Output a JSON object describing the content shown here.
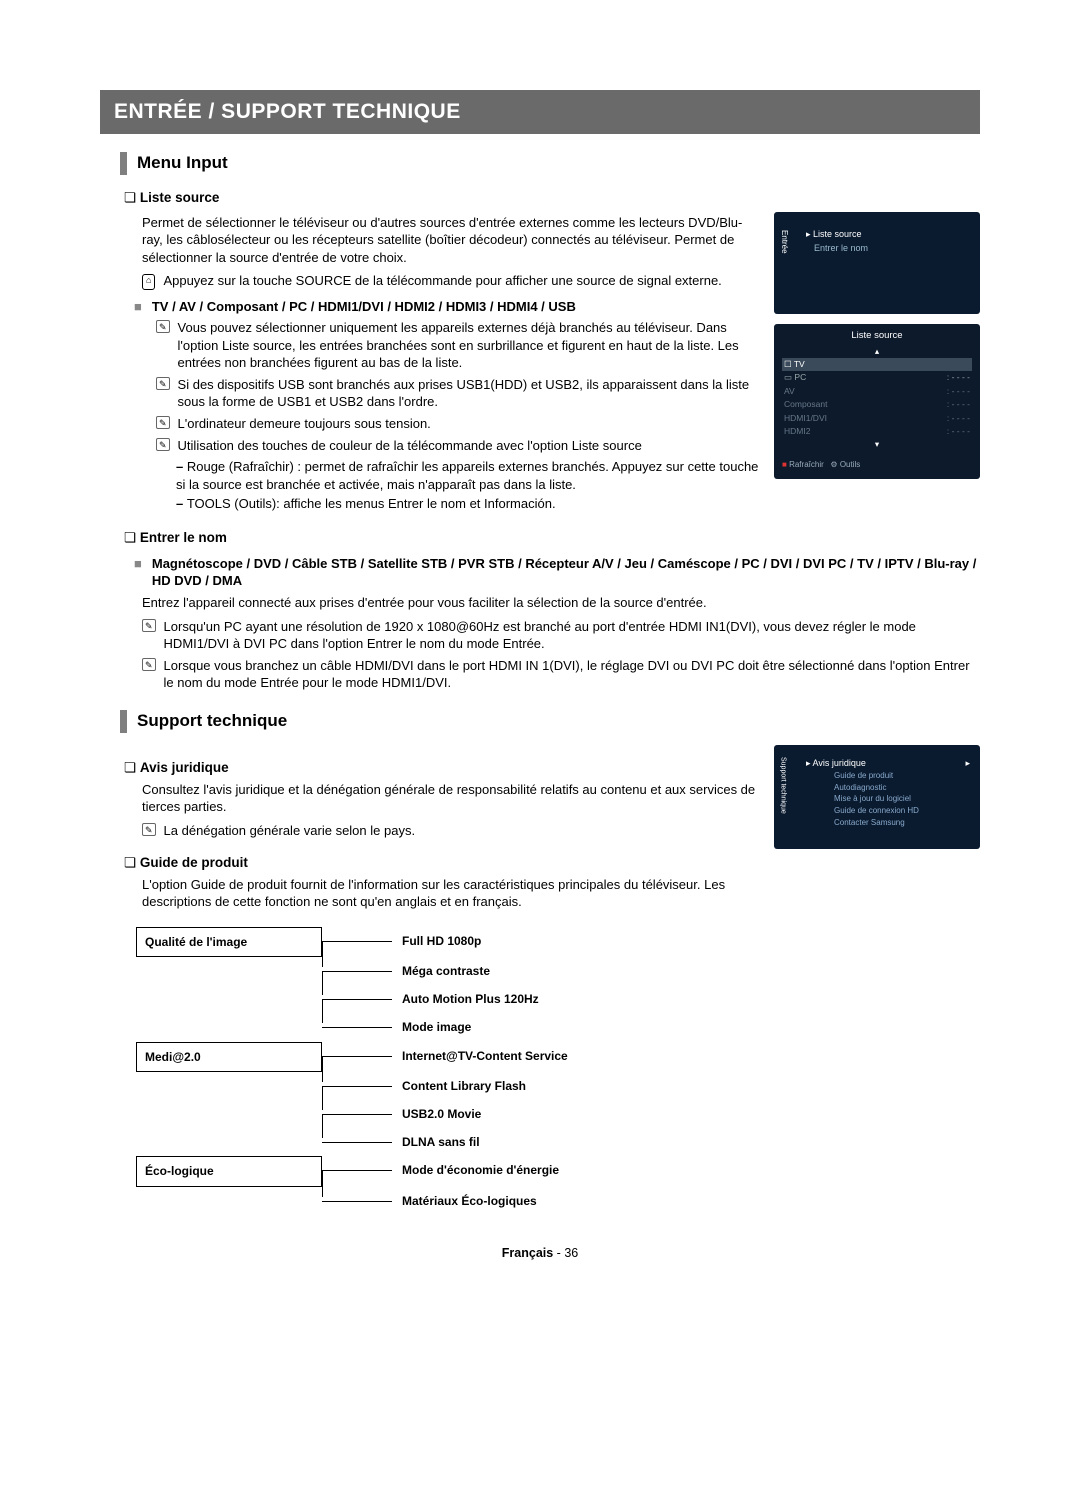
{
  "title_bar": "ENTRÉE / SUPPORT TECHNIQUE",
  "menu_input": {
    "heading": "Menu Input",
    "liste_source": {
      "title": "Liste source",
      "desc": "Permet de sélectionner le téléviseur ou d'autres sources d'entrée externes comme les lecteurs DVD/Blu-ray, les câblosélecteur ou les récepteurs satellite (boîtier décodeur) connectés au téléviseur. Permet de sélectionner la source d'entrée de votre choix.",
      "remote_note": "Appuyez sur la touche SOURCE de la télécommande pour afficher une source de signal externe.",
      "sources_list": "TV / AV / Composant / PC / HDMI1/DVI / HDMI2 / HDMI3 / HDMI4 / USB",
      "note1": "Vous pouvez sélectionner uniquement les appareils externes déjà branchés au téléviseur. Dans l'option Liste source, les entrées branchées sont en surbrillance et figurent en haut de la liste. Les entrées non branchées figurent au bas de la liste.",
      "note2": "Si des dispositifs USB sont branchés aux prises USB1(HDD) et USB2, ils apparaissent dans la liste sous la forme de USB1 et USB2 dans l'ordre.",
      "note3": "L'ordinateur demeure toujours sous tension.",
      "note4": "Utilisation des touches de couleur de la télécommande avec l'option Liste source",
      "dash1": "Rouge (Rafraîchir) : permet de rafraîchir les appareils externes branchés. Appuyez sur cette touche si la source est branchée et activée, mais n'apparaît pas dans la liste.",
      "dash2": "TOOLS (Outils): affiche les menus Entrer le nom et Información."
    },
    "entrer_nom": {
      "title": "Entrer le nom",
      "devices": "Magnétoscope / DVD / Câble STB / Satellite STB / PVR STB / Récepteur A/V / Jeu / Caméscope / PC / DVI / DVI PC / TV / IPTV / Blu-ray / HD DVD / DMA",
      "desc": "Entrez l'appareil connecté aux prises d'entrée pour vous faciliter la sélection de la source d'entrée.",
      "note1": "Lorsqu'un PC ayant une résolution de 1920 x 1080@60Hz est branché au port d'entrée HDMI IN1(DVI), vous devez régler le mode HDMI1/DVI à DVI PC dans l'option Entrer le nom du mode Entrée.",
      "note2": "Lorsque vous branchez un câble HDMI/DVI dans le port HDMI IN 1(DVI), le réglage DVI ou DVI PC doit être sélectionné dans l'option Entrer le nom du mode Entrée pour le mode HDMI1/DVI."
    }
  },
  "support": {
    "heading": "Support technique",
    "avis": {
      "title": "Avis juridique",
      "desc": "Consultez l'avis juridique et la dénégation générale de responsabilité relatifs au contenu et aux services de tierces parties.",
      "note": "La dénégation générale varie selon le pays."
    },
    "guide": {
      "title": "Guide de produit",
      "desc": "L'option Guide de produit fournit de l'information sur les caractéristiques principales du téléviseur. Les descriptions de cette fonction ne sont qu'en anglais et en français."
    },
    "features": {
      "quality": {
        "label": "Qualité de l'image",
        "items": [
          "Full HD 1080p",
          "Méga contraste",
          "Auto Motion Plus 120Hz",
          "Mode image"
        ]
      },
      "media": {
        "label": "Medi@2.0",
        "items": [
          "Internet@TV-Content Service",
          "Content Library Flash",
          "USB2.0 Movie",
          "DLNA sans fil"
        ]
      },
      "eco": {
        "label": "Éco-logique",
        "items": [
          "Mode d'économie d'énergie",
          "Matériaux Éco-logiques"
        ]
      }
    }
  },
  "osd1": {
    "item1": "Liste source",
    "item2": "Entrer le nom",
    "side": "Entrée"
  },
  "osd2": {
    "title": "Liste source",
    "rows": [
      "TV",
      "PC",
      "AV",
      "Composant",
      "HDMI1/DVI",
      "HDMI2"
    ],
    "dash": ": - - - -",
    "footer_l": "Rafraîchir",
    "footer_r": "Outils"
  },
  "osd3": {
    "side": "Support technique",
    "item": "Avis juridique",
    "subs": [
      "Guide de produit",
      "Autodiagnostic",
      "Mise à jour du logiciel",
      "Guide de connexion HD",
      "Contacter Samsung"
    ]
  },
  "footer": {
    "lang": "Français",
    "page": "36"
  }
}
